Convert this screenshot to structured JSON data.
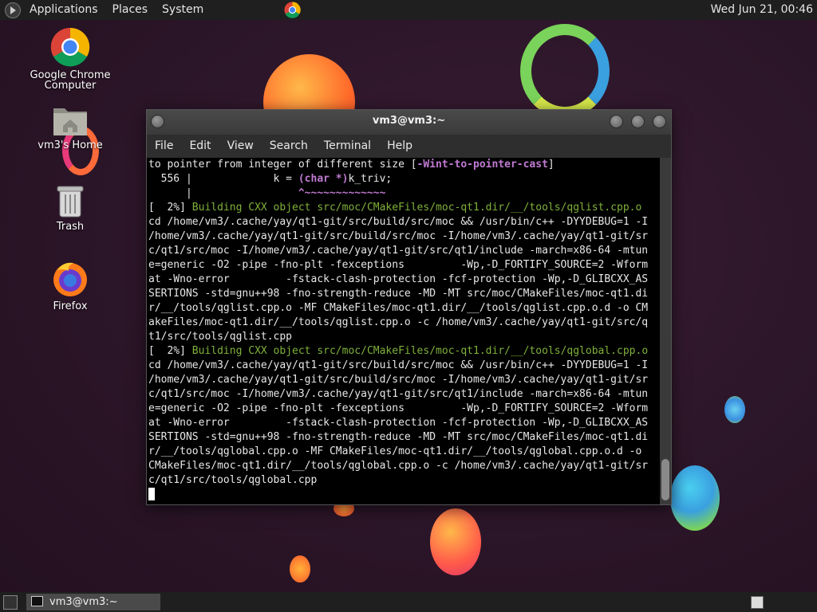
{
  "top_panel": {
    "menus": [
      "Applications",
      "Places",
      "System"
    ],
    "clock": "Wed Jun 21, 00:46"
  },
  "desktop_icons": [
    {
      "label": "Google Chrome",
      "sub": "Computer",
      "icon": "chrome-icon"
    },
    {
      "label": "vm3's Home",
      "icon": "home-folder-icon"
    },
    {
      "label": "Trash",
      "icon": "trash-icon"
    },
    {
      "label": "Firefox",
      "icon": "firefox-icon"
    }
  ],
  "terminal": {
    "title": "vm3@vm3:~",
    "menus": [
      "File",
      "Edit",
      "View",
      "Search",
      "Terminal",
      "Help"
    ],
    "lines": [
      [
        {
          "t": "to pointer from integer of different size ["
        },
        {
          "t": "-Wint-to-pointer-cast",
          "c": "purp"
        },
        {
          "t": "]"
        }
      ],
      [
        {
          "t": "  556 |             k = "
        },
        {
          "t": "(char *)",
          "c": "purp"
        },
        {
          "t": "k_triv;"
        }
      ],
      [
        {
          "t": "      |                 "
        },
        {
          "t": "^~~~~~~~~~~~~~",
          "c": "purp"
        }
      ],
      [
        {
          "t": "[  2%] "
        },
        {
          "t": "Building CXX object src/moc/CMakeFiles/moc-qt1.dir/__/tools/qglist.cpp.o",
          "c": "green"
        }
      ],
      [
        {
          "t": "cd /home/vm3/.cache/yay/qt1-git/src/build/src/moc && /usr/bin/c++ -DYYDEBUG=1 -I"
        }
      ],
      [
        {
          "t": "/home/vm3/.cache/yay/qt1-git/src/build/src/moc -I/home/vm3/.cache/yay/qt1-git/sr"
        }
      ],
      [
        {
          "t": "c/qt1/src/moc -I/home/vm3/.cache/yay/qt1-git/src/qt1/include -march=x86-64 -mtun"
        }
      ],
      [
        {
          "t": "e=generic -O2 -pipe -fno-plt -fexceptions         -Wp,-D_FORTIFY_SOURCE=2 -Wform"
        }
      ],
      [
        {
          "t": "at -Wno-error         -fstack-clash-protection -fcf-protection -Wp,-D_GLIBCXX_AS"
        }
      ],
      [
        {
          "t": "SERTIONS -std=gnu++98 -fno-strength-reduce -MD -MT src/moc/CMakeFiles/moc-qt1.di"
        }
      ],
      [
        {
          "t": "r/__/tools/qglist.cpp.o -MF CMakeFiles/moc-qt1.dir/__/tools/qglist.cpp.o.d -o CM"
        }
      ],
      [
        {
          "t": "akeFiles/moc-qt1.dir/__/tools/qglist.cpp.o -c /home/vm3/.cache/yay/qt1-git/src/q"
        }
      ],
      [
        {
          "t": "t1/src/tools/qglist.cpp"
        }
      ],
      [
        {
          "t": "[  2%] "
        },
        {
          "t": "Building CXX object src/moc/CMakeFiles/moc-qt1.dir/__/tools/qglobal.cpp.o",
          "c": "green"
        }
      ],
      [
        {
          "t": "cd /home/vm3/.cache/yay/qt1-git/src/build/src/moc && /usr/bin/c++ -DYYDEBUG=1 -I"
        }
      ],
      [
        {
          "t": "/home/vm3/.cache/yay/qt1-git/src/build/src/moc -I/home/vm3/.cache/yay/qt1-git/sr"
        }
      ],
      [
        {
          "t": "c/qt1/src/moc -I/home/vm3/.cache/yay/qt1-git/src/qt1/include -march=x86-64 -mtun"
        }
      ],
      [
        {
          "t": "e=generic -O2 -pipe -fno-plt -fexceptions         -Wp,-D_FORTIFY_SOURCE=2 -Wform"
        }
      ],
      [
        {
          "t": "at -Wno-error         -fstack-clash-protection -fcf-protection -Wp,-D_GLIBCXX_AS"
        }
      ],
      [
        {
          "t": "SERTIONS -std=gnu++98 -fno-strength-reduce -MD -MT src/moc/CMakeFiles/moc-qt1.di"
        }
      ],
      [
        {
          "t": "r/__/tools/qglobal.cpp.o -MF CMakeFiles/moc-qt1.dir/__/tools/qglobal.cpp.o.d -o "
        }
      ],
      [
        {
          "t": "CMakeFiles/moc-qt1.dir/__/tools/qglobal.cpp.o -c /home/vm3/.cache/yay/qt1-git/sr"
        }
      ],
      [
        {
          "t": "c/qt1/src/tools/qglobal.cpp"
        }
      ]
    ]
  },
  "taskbar": {
    "task_label": "vm3@vm3:~"
  },
  "colors": {
    "build_green": "#7fb13a",
    "warning_purple": "#c07ad2",
    "panel_bg": "#1f1f1f"
  }
}
